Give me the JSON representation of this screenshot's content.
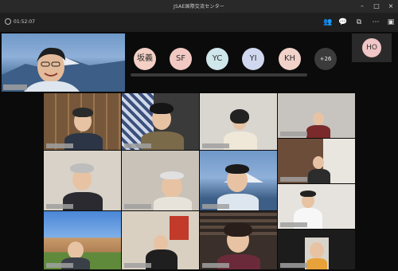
{
  "window": {
    "title": "JSAE国際交流センター"
  },
  "header": {
    "elapsed_time": "01:52:07"
  },
  "icons": {
    "timer": "clock-icon",
    "participants": "people-icon",
    "chat": "chat-icon",
    "rooms": "breakout-rooms-icon",
    "more": "more-icon",
    "window_min": "minimize-icon",
    "window_max": "maximize-icon",
    "window_close": "close-icon"
  },
  "avatars": [
    {
      "initials": "坂義",
      "color": "#f3cfc4"
    },
    {
      "initials": "SF",
      "color": "#f2c8c2"
    },
    {
      "initials": "YC",
      "color": "#cfe6ea"
    },
    {
      "initials": "YI",
      "color": "#cfd8ee"
    },
    {
      "initials": "KH",
      "color": "#f1d2c9"
    }
  ],
  "overflow_count": "+26",
  "pinned_participant": {
    "initials": "HO",
    "color": "#f0c6c6"
  }
}
